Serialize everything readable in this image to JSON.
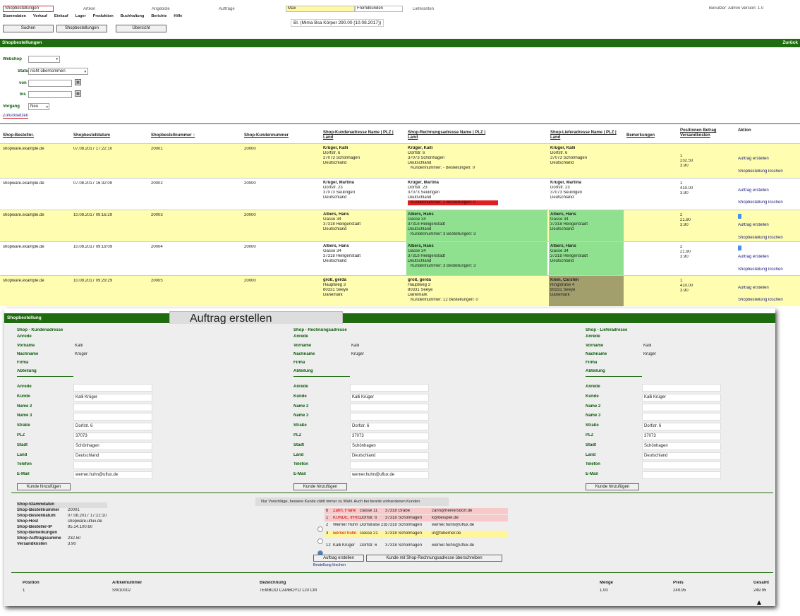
{
  "topbar": {
    "selected_tab": "Shopbestellungen",
    "tab2": "Artikel",
    "tab3": "Angebote",
    "tab4": "Aufträge",
    "filter_value": "Max",
    "filter2": "Fremdkunden",
    "filter3": "Lieferanten",
    "user_info": "Benutzer: Admin  Version: 1.0",
    "menu": [
      "Stammdaten",
      "Verkauf",
      "Einkauf",
      "Lager",
      "Produktion",
      "Buchhaltung",
      "Berichte",
      "Hilfe"
    ],
    "btn_search": "Suchen",
    "btn_orders": "Shopbestellungen",
    "btn_overview": "Übersicht",
    "info_line": "Bl. (Mima Bsa Körper 290.00 (10.08.2017))"
  },
  "section_bar": {
    "title": "Shopbestellungen",
    "right": "Zurück"
  },
  "filters": {
    "webshop_label": "Webshop",
    "status_label": "Status",
    "status_value": "nicht übernommen",
    "von_label": "von",
    "bis_label": "bis",
    "vorgang_label": "Vorgang",
    "vorgang_value": "Neu",
    "reset_link": "Zurücksetzen"
  },
  "table": {
    "headers": [
      "Shop-Bestellnr.",
      "Shopbestelldatum",
      "Shopbestellnummer ↑",
      "Shop-Kundennummer",
      "Shop-Kundenadresse Name | PLZ | Land",
      "Shop-Rechnungsadresse Name | PLZ | Land",
      "Shop-Lieferadresse Name | PLZ | Land",
      "Bemerkungen",
      "Positionen Betrag Versandkosten",
      "Aktion"
    ],
    "rows": [
      {
        "shop": "shopware.example.de",
        "date": "07.08.2017 17:22:10",
        "nr": "20001",
        "kdnr": "20000",
        "kunde": [
          "Krüger, Kalli",
          "Dorfstr. 6",
          "37073 Schönhagen",
          "Deutschland"
        ],
        "rechnung": [
          "Krüger, Kalli",
          "Dorfstr. 6",
          "37073 Schönhagen",
          "Deutschland",
          "Kundennummer: -  Bestellungen: 0"
        ],
        "liefer": [
          "Krüger, Kalli",
          "Dorfstr. 6",
          "37073 Schönhagen",
          "Deutschland"
        ],
        "pos": [
          "1",
          "232.50",
          "3.90"
        ],
        "a1": "Auftrag erstellen",
        "a2": "Shopbestellung löschen",
        "y": true
      },
      {
        "shop": "shopware.example.de",
        "date": "07.08.2017 16:32:09",
        "nr": "20002",
        "kdnr": "20000",
        "kunde": [
          "Krüger, Martina",
          "Dorfstr. 23",
          "37073 Seulingen",
          "Deutschland"
        ],
        "rechnung": [
          "Krüger, Martina",
          "Dorfstr. 23",
          "37073 Seulingen",
          "Deutschland",
          "Kundennummer: 1  Bestellungen: 0"
        ],
        "liefer": [
          "Krüger, Martina",
          "Dorfstr. 23",
          "37073 Seulingen",
          "Deutschland"
        ],
        "pos": [
          "1",
          "410.00",
          "3.90"
        ],
        "a1": "Auftrag erstellen",
        "a2": "Shopbestellung löschen",
        "y": false
      },
      {
        "shop": "shopware.example.de",
        "date": "10.08.2017 09:16:29",
        "nr": "20003",
        "kdnr": "20000",
        "kunde": [
          "Albers, Hans",
          "Gasse 34",
          "37318 Heiligenstadt",
          "Deutschland"
        ],
        "rechnung": [
          "Albers, Hans",
          "Gasse 34",
          "37318 Heiligenstadt",
          "Deutschland",
          "Kundennummer: 3  Bestellungen: 3"
        ],
        "liefer": [
          "Albers, Hans",
          "Gasse 34",
          "37318 Heiligenstadt",
          "Deutschland"
        ],
        "pos": [
          "2",
          "21.90",
          "3.90"
        ],
        "a1": "Auftrag erstellen",
        "a2": "Shopbestellung löschen",
        "y": true
      },
      {
        "shop": "shopware.example.de",
        "date": "10.08.2017 09:19:09",
        "nr": "20004",
        "kdnr": "20000",
        "kunde": [
          "Albers, Hans",
          "Gasse 34",
          "37318 Heiligenstadt",
          "Deutschland"
        ],
        "rechnung": [
          "Albers, Hans",
          "Gasse 34",
          "37318 Heiligenstadt",
          "Deutschland",
          "Kundennummer: 3  Bestellungen: 3"
        ],
        "liefer": [
          "Albers, Hans",
          "Gasse 34",
          "37318 Heiligenstadt",
          "Deutschland"
        ],
        "pos": [
          "2",
          "21.90",
          "3.90"
        ],
        "a1": "Auftrag erstellen",
        "a2": "Shopbestellung löschen",
        "y": false
      },
      {
        "shop": "shopware.example.de",
        "date": "10.08.2017 09:29:29",
        "nr": "20005",
        "kdnr": "20000",
        "kunde": [
          "groß, gerda",
          "Hauptweg 3",
          "80331 Seeye",
          "Dänemark"
        ],
        "rechnung": [
          "groß, gerda",
          "Hauptweg 3",
          "80331 Seeye",
          "Dänemark",
          "Kundennummer: 12  Bestellungen: 0"
        ],
        "liefer": [
          "Klein, Carsten",
          "Ringstraße 4",
          "80331 Seeye",
          "Dänemark"
        ],
        "pos": [
          "1",
          "410.00",
          "3.90"
        ],
        "a1": "Auftrag erstellen",
        "a2": "Shopbestellung löschen",
        "y": true
      }
    ]
  },
  "modal": {
    "title": "Shopbestellung",
    "tooltip": "Auftrag erstellen",
    "columns": [
      {
        "head": "Shop - Kundenadresse",
        "anrede": "Anrede",
        "vorname_l": "Vorname",
        "vorname": "Kalli",
        "nachname_l": "Nachname",
        "nachname": "Krüger",
        "firma": "Firma",
        "abteilung": "Abteilung",
        "f": {
          "anrede": "",
          "kunde": "Kalli Krüger",
          "name2": "",
          "name3": "",
          "strasse": "Dorfstr. 6",
          "plz": "37073",
          "stadt": "Schönhagen",
          "land": "Deutschland",
          "telefon": "",
          "email": "werner.huhn@uflux.de"
        },
        "btn": "Kunde hinzufügen"
      },
      {
        "head": "Shop - Rechnungsadresse",
        "anrede": "Anrede",
        "vorname_l": "Vorname",
        "vorname": "Kalli",
        "nachname_l": "Nachname",
        "nachname": "Krüger",
        "firma": "Firma",
        "abteilung": "Abteilung",
        "f": {
          "anrede": "",
          "kunde": "Kalli Krüger",
          "name2": "",
          "name3": "",
          "strasse": "Dorfstr. 6",
          "plz": "37073",
          "stadt": "Schönhagen",
          "land": "Deutschland",
          "telefon": "",
          "email": "werner.huhn@uflux.de"
        },
        "btn": "Kunde hinzufügen"
      },
      {
        "head": "Shop - Lieferadresse",
        "anrede": "Anrede",
        "vorname_l": "Vorname",
        "vorname": "Kalli",
        "nachname_l": "Nachname",
        "nachname": "Krüger",
        "firma": "Firma",
        "abteilung": "Abteilung",
        "f": {
          "anrede": "",
          "kunde": "Kalli Krüger",
          "name2": "",
          "name3": "",
          "strasse": "Dorfstr. 6",
          "plz": "37073",
          "stadt": "Schönhagen",
          "land": "Deutschland",
          "telefon": "",
          "email": ""
        },
        "btn": "Kunde hinzufügen"
      }
    ],
    "field_labels": {
      "anrede": "Anrede",
      "kunde": "Kunde",
      "name2": "Name 2",
      "name3": "Name 3",
      "strasse": "Straße",
      "plz": "PLZ",
      "stadt": "Stadt",
      "land": "Land",
      "telefon": "Telefon",
      "email": "E-Mail"
    },
    "info": [
      [
        "Shop-Stammdaten",
        ""
      ],
      [
        "Shop-Bestellnummer",
        "20001"
      ],
      [
        "Shop-Bestelldatum",
        "07.08.2017 17:22:10"
      ],
      [
        "Shop-Host",
        "shopware.uflux.de"
      ],
      [
        "Shop-Besteller-IP",
        "95.14.100.60"
      ],
      [
        "Shop-Bemerkungen",
        ""
      ],
      [
        "Shop-Auftragssumme",
        "232.50"
      ],
      [
        "Versandkosten",
        "3.90"
      ]
    ],
    "hint": "Nur Vorschläge, bessere Kunde zählt immer zu Wahl. Auch bei bereits vorhandenen Kunden",
    "candidates": [
      {
        "nr": "6",
        "name": "Zahn, Frank",
        "addr": "Gasse 11",
        "ort": "37318 Grabe",
        "mail": "zahn@heinersdorf.de",
        "style": "red"
      },
      {
        "nr": "1",
        "name": "KUNDE, IHRE",
        "addr": "Dorfstr. 6",
        "ort": "37318 Schönhagen",
        "mail": "k@beispiel.de",
        "style": "red"
      },
      {
        "nr": "2",
        "name": "Werner Huhn",
        "addr": "Dorfstraße 23",
        "ort": "37318 Schönhagen",
        "mail": "werner.huhn@uflux.de",
        "style": "plain"
      },
      {
        "nr": "3",
        "name": "werner huhn",
        "addr": "Gasse 21",
        "ort": "37318 Schönhagen",
        "mail": "uf@fuberner.de",
        "style": "yellow"
      },
      {
        "nr": "12",
        "name": "Kalli Krüger",
        "addr": "Dorfstr. 6",
        "ort": "37318 Schönhagen",
        "mail": "werner.huhn@uflux.de",
        "style": "plain"
      }
    ],
    "btn_create": "Auftrag erstellen",
    "btn_overwrite": "Kunde mit Shop-Rechnungsadresse überschreiben",
    "link_erledigt": "Bestellung löschen",
    "items_headers": [
      "Position",
      "Artikelnummer",
      "Bezeichnung",
      "Menge",
      "Preis",
      "Gesamt"
    ],
    "items": [
      [
        "1",
        "SW10002",
        "TEMBOO CAMBOYO 120 CM",
        "1.00",
        "249.95",
        "249.95"
      ]
    ]
  },
  "colors": {
    "green": "#1f6b0f",
    "yellow": "#fffdb0",
    "lightgreen": "#8fe08f",
    "olive": "#a39f6d",
    "red": "#e02020"
  }
}
